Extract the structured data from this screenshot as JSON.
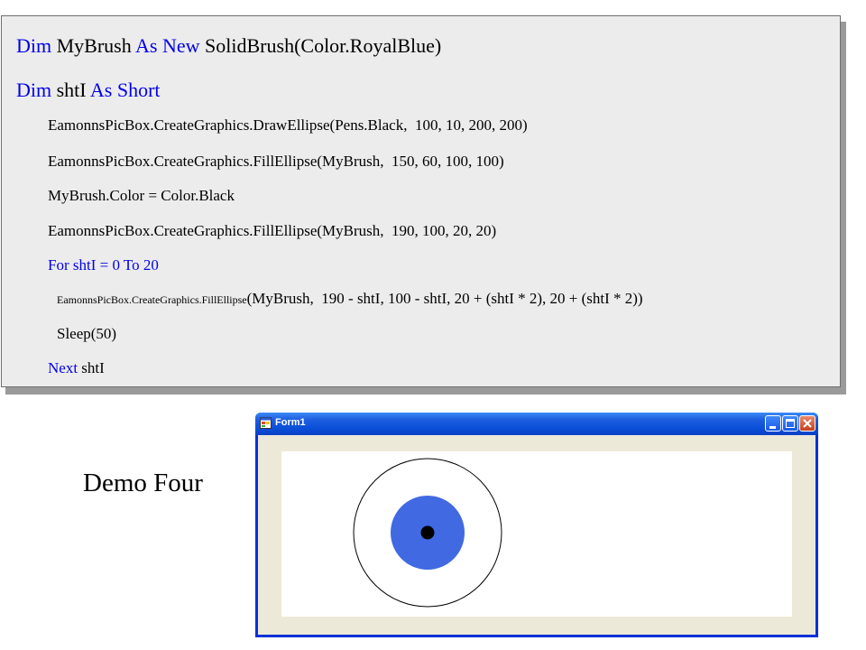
{
  "code": {
    "line1": {
      "kw1": "Dim",
      "t1": " MyBrush ",
      "kw2": "As New",
      "t2": " SolidBrush(Color.RoyalBlue)"
    },
    "line2": {
      "kw1": "Dim",
      "t1": " shtI ",
      "kw2": "As Short"
    },
    "line3": "EamonnsPicBox.CreateGraphics.DrawEllipse(Pens.Black,  100, 10, 200, 200)",
    "line4": "EamonnsPicBox.CreateGraphics.FillEllipse(MyBrush,  150, 60, 100, 100)",
    "line5": "MyBrush.Color = Color.Black",
    "line6": "EamonnsPicBox.CreateGraphics.FillEllipse(MyBrush,  190, 100, 20, 20)",
    "line7": "For shtI = 0 To 20",
    "line8": {
      "small": "EamonnsPicBox.CreateGraphics.FillEllipse",
      "rest": "(MyBrush,  190 - shtI, 100 - shtI, 20 + (shtI * 2), 20 + (shtI * 2))"
    },
    "line9": "Sleep(50)",
    "line10": {
      "kw": "Next",
      "t": " shtI"
    }
  },
  "caption": "Demo Four",
  "window": {
    "title": "Form1",
    "icon": "form-app-icon",
    "buttons": [
      "minimize-icon",
      "maximize-icon",
      "close-icon"
    ]
  },
  "drawing": {
    "outer_circle_color": "#000000",
    "fill_circle_color": "#4169e1",
    "center_dot_color": "#000000"
  },
  "colors": {
    "keyword": "#0000ee",
    "code_background": "#ececec",
    "title_bar": "#0a4fd8",
    "client_area": "#ece9d8"
  }
}
